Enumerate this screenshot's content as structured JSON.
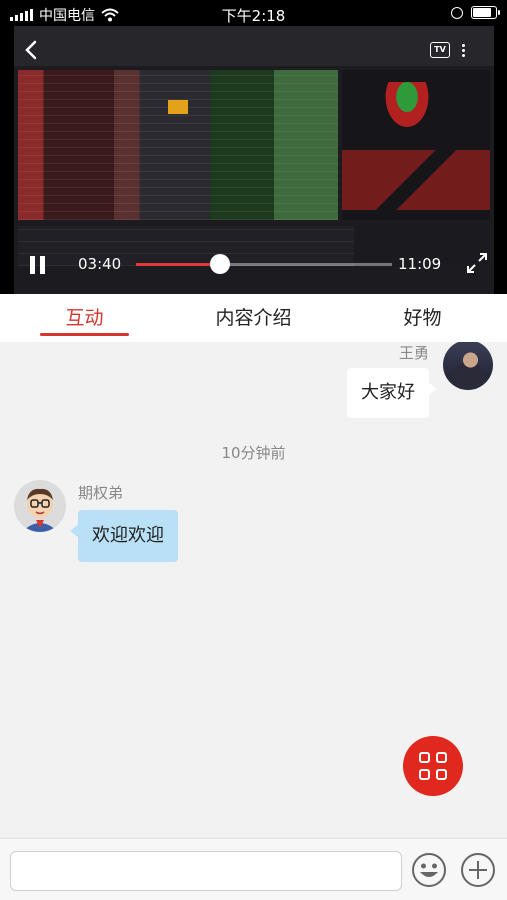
{
  "status_bar": {
    "carrier": "中国电信",
    "time": "下午2:18"
  },
  "video": {
    "current_time": "03:40",
    "total_time": "11:09",
    "tv_label": "TV",
    "progress": 0.33
  },
  "tabs": [
    {
      "label": "互动"
    },
    {
      "label": "内容介绍"
    },
    {
      "label": "好物"
    }
  ],
  "chat": {
    "messages": [
      {
        "sender": "王勇",
        "text": "大家好"
      },
      {
        "sender": "期权弟",
        "text": "欢迎欢迎"
      }
    ],
    "timestamp": "10分钟前"
  },
  "input": {
    "placeholder": "",
    "value": ""
  },
  "colors": {
    "accent": "#d6352d",
    "fab": "#e0281e",
    "bubble_left": "#b9e0f6"
  }
}
